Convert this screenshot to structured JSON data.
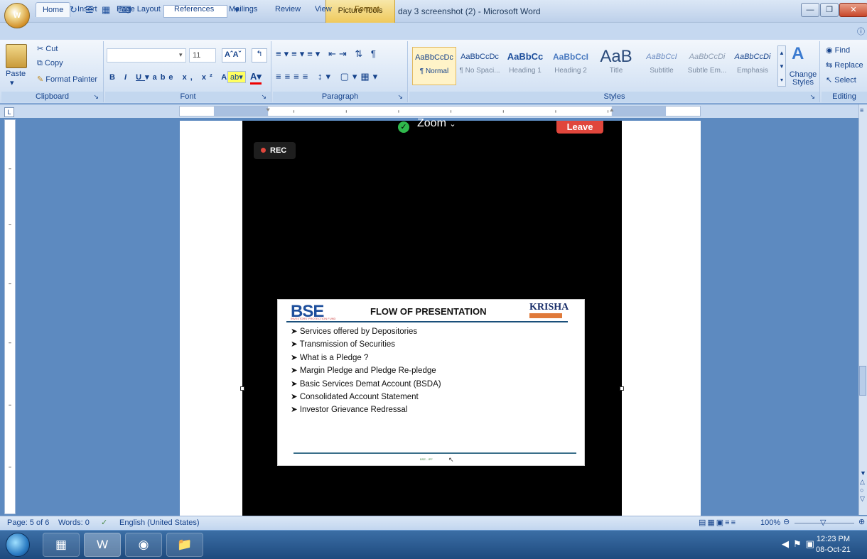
{
  "window": {
    "context_tab": "Picture Tools",
    "title": "day 3 screenshot (2) - Microsoft Word",
    "office_button": "W"
  },
  "tabs": [
    "Home",
    "Insert",
    "Page Layout",
    "References",
    "Mailings",
    "Review",
    "View",
    "Format"
  ],
  "clipboard": {
    "paste": "Paste",
    "cut": "Cut",
    "copy": "Copy",
    "format_painter": "Format Painter",
    "label": "Clipboard"
  },
  "font": {
    "font_name": "",
    "font_size": "11",
    "label": "Font"
  },
  "paragraph": {
    "label": "Paragraph"
  },
  "styles": {
    "items": [
      {
        "preview": "AaBbCcDc",
        "name": "¶ Normal"
      },
      {
        "preview": "AaBbCcDc",
        "name": "¶ No Spaci..."
      },
      {
        "preview": "AaBbCc",
        "name": "Heading 1"
      },
      {
        "preview": "AaBbCcI",
        "name": "Heading 2"
      },
      {
        "preview": "AaB",
        "name": "Title"
      },
      {
        "preview": "AaBbCcI",
        "name": "Subtitle"
      },
      {
        "preview": "AaBbCcDi",
        "name": "Subtle Em..."
      },
      {
        "preview": "AaBbCcDi",
        "name": "Emphasis"
      }
    ],
    "change_styles": "Change Styles",
    "label": "Styles"
  },
  "editing": {
    "find": "Find",
    "replace": "Replace",
    "select": "Select",
    "label": "Editing"
  },
  "zoom_meeting": {
    "app_label": "Zoom",
    "leave_button": "Leave",
    "rec_badge": "REC"
  },
  "slide": {
    "logo_text": "BSE",
    "logo_subtext": "INVESTORS' PROTECTION FUND",
    "title": "FLOW OF PRESENTATION",
    "partner_logo": "KRISHA",
    "bullets": [
      "Services offered by Depositories",
      "Transmission of Securities",
      "What is a Pledge ?",
      "Margin Pledge and Pledge Re-pledge",
      "Basic Services Demat Account (BSDA)",
      "Consolidated Account Statement",
      "Investor Grievance Redressal"
    ],
    "footer": "BSE - IPF"
  },
  "statusbar": {
    "page": "Page: 5 of 6",
    "words": "Words: 0",
    "language": "English (United States)",
    "zoom": "100%"
  },
  "taskbar": {
    "time": "12:23 PM",
    "date": "08-Oct-21"
  }
}
